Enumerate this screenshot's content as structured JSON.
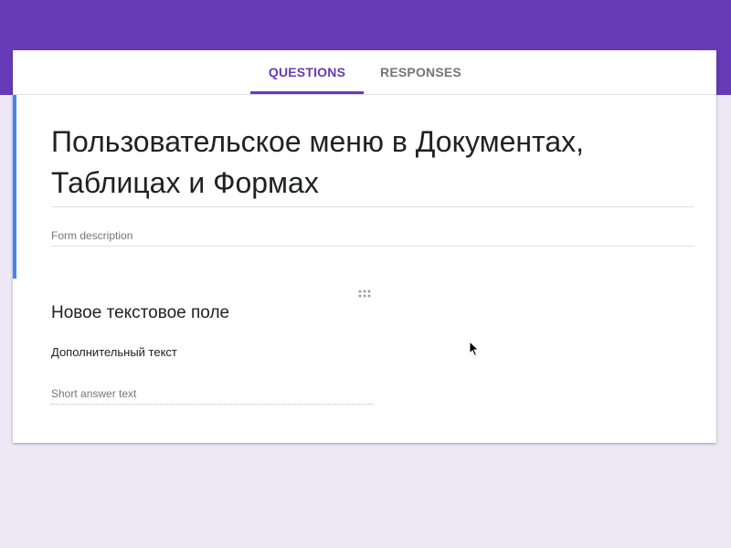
{
  "tabs": [
    {
      "label": "QUESTIONS",
      "active": true
    },
    {
      "label": "RESPONSES",
      "active": false
    }
  ],
  "form": {
    "title": "Пользовательское меню в Документах, Таблицах и Формах",
    "description_placeholder": "Form description"
  },
  "question": {
    "title": "Новое текстовое поле",
    "description": "Дополнительный текст",
    "answer_placeholder": "Short answer text"
  },
  "colors": {
    "header": "#673ab7",
    "background": "#ede7f6",
    "accent": "#4285f4",
    "tab_active": "#673ab7"
  },
  "icons": {
    "drag_handle": "drag-handle-icon",
    "cursor": "mouse-pointer-icon"
  }
}
